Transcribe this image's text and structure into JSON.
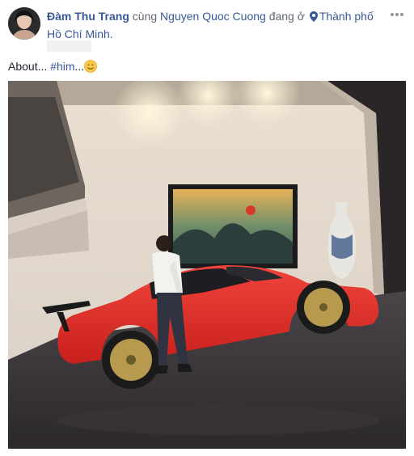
{
  "post": {
    "author": "Đàm Thu Trang",
    "with_word": "cùng",
    "tagged_user": "Nguyen Quoc Cuong",
    "at_word": "đang ở",
    "location_line1": "Thành phố",
    "location_line2": "Hồ Chí Minh.",
    "caption_text": "About... ",
    "hashtag": "#him",
    "caption_suffix": "...",
    "more_icon_label": "•••"
  },
  "icons": {
    "location": "location-pin-icon",
    "more": "more-options-icon",
    "emoji": "smiling-face-emoji"
  }
}
